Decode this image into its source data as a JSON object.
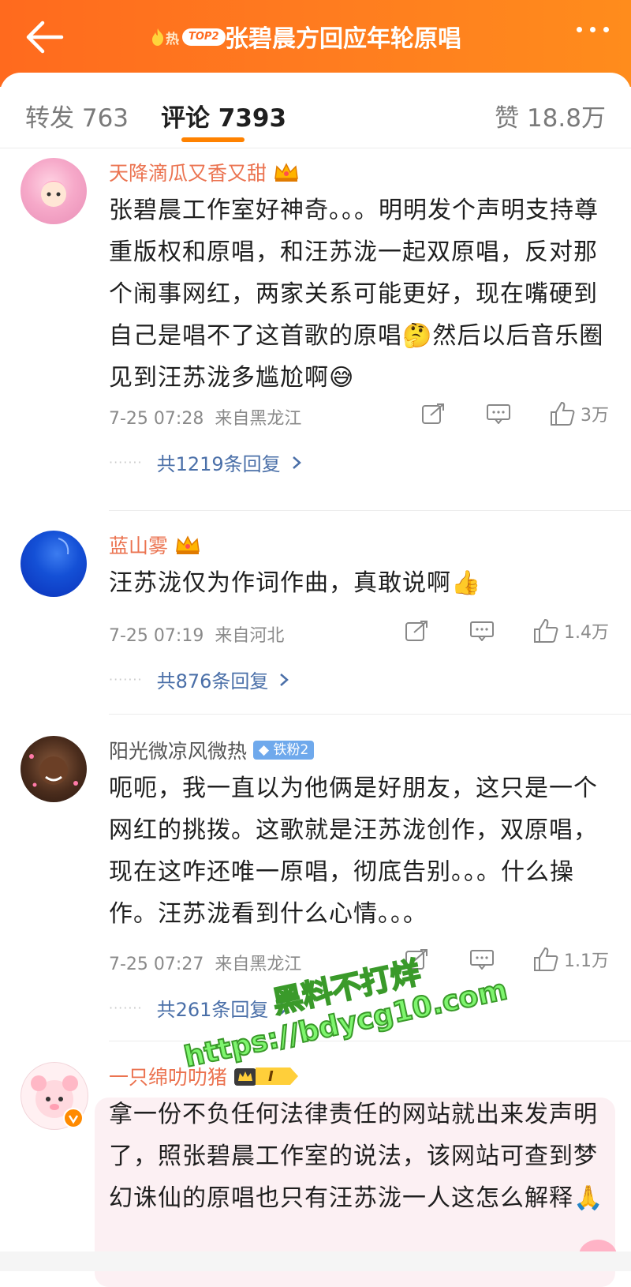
{
  "header": {
    "hot_word": "热",
    "rank_badge": "TOP2",
    "title": "张碧晨方回应年轮原唱",
    "back_icon": "back-arrow-icon",
    "more_icon": "more-dots-icon",
    "background": "#ff7a1f"
  },
  "tabs": {
    "repost": "转发 763",
    "comment": "评论 7393",
    "like": "赞 18.8万",
    "active": "comment",
    "accent": "#ff8200"
  },
  "comments": [
    {
      "user": "天降滴瓜又香又甜",
      "badge": "crown-icon",
      "text": "张碧晨工作室好神奇。。。明明发个声明支持尊重版权和原唱，和汪苏泷一起双原唱，反对那个闹事网红，两家关系可能更好，现在嘴硬到自己是唱不了这首歌的原唱🤔然后以后音乐圈见到汪苏泷多尴尬啊😅",
      "time": "7-25 07:28",
      "location": "来自黑龙江",
      "likes": "3万",
      "replies": "共1219条回复"
    },
    {
      "user": "蓝山雾",
      "badge": "crown-icon",
      "text": "汪苏泷仅为作词作曲，真敢说啊👍",
      "time": "7-25 07:19",
      "location": "来自河北",
      "likes": "1.4万",
      "replies": "共876条回复"
    },
    {
      "user": "阳光微凉风微热",
      "badge": "铁粉2",
      "text": "呃呃，我一直以为他俩是好朋友，这只是一个网红的挑拨。这歌就是汪苏泷创作，双原唱，现在这咋还唯一原唱，彻底告别。。。什么操作。汪苏泷看到什么心情。。。",
      "time": "7-25 07:27",
      "location": "来自黑龙江",
      "likes": "1.1万",
      "replies": "共261条回复"
    },
    {
      "user": "一只绵叻叻猪",
      "badge": "I",
      "text": "拿一份不负任何法律责任的网站就出来发声明了，照张碧晨工作室的说法，该网站可查到梦幻诛仙的原唱也只有汪苏泷一人这怎么解释🙏"
    }
  ],
  "watermark": {
    "line1": "黑料不打烊",
    "line2": "https://bdycg10.com"
  },
  "colors": {
    "username": "#eb7350",
    "reply_link": "#4a6fa8",
    "meta": "#8a8a8a"
  }
}
